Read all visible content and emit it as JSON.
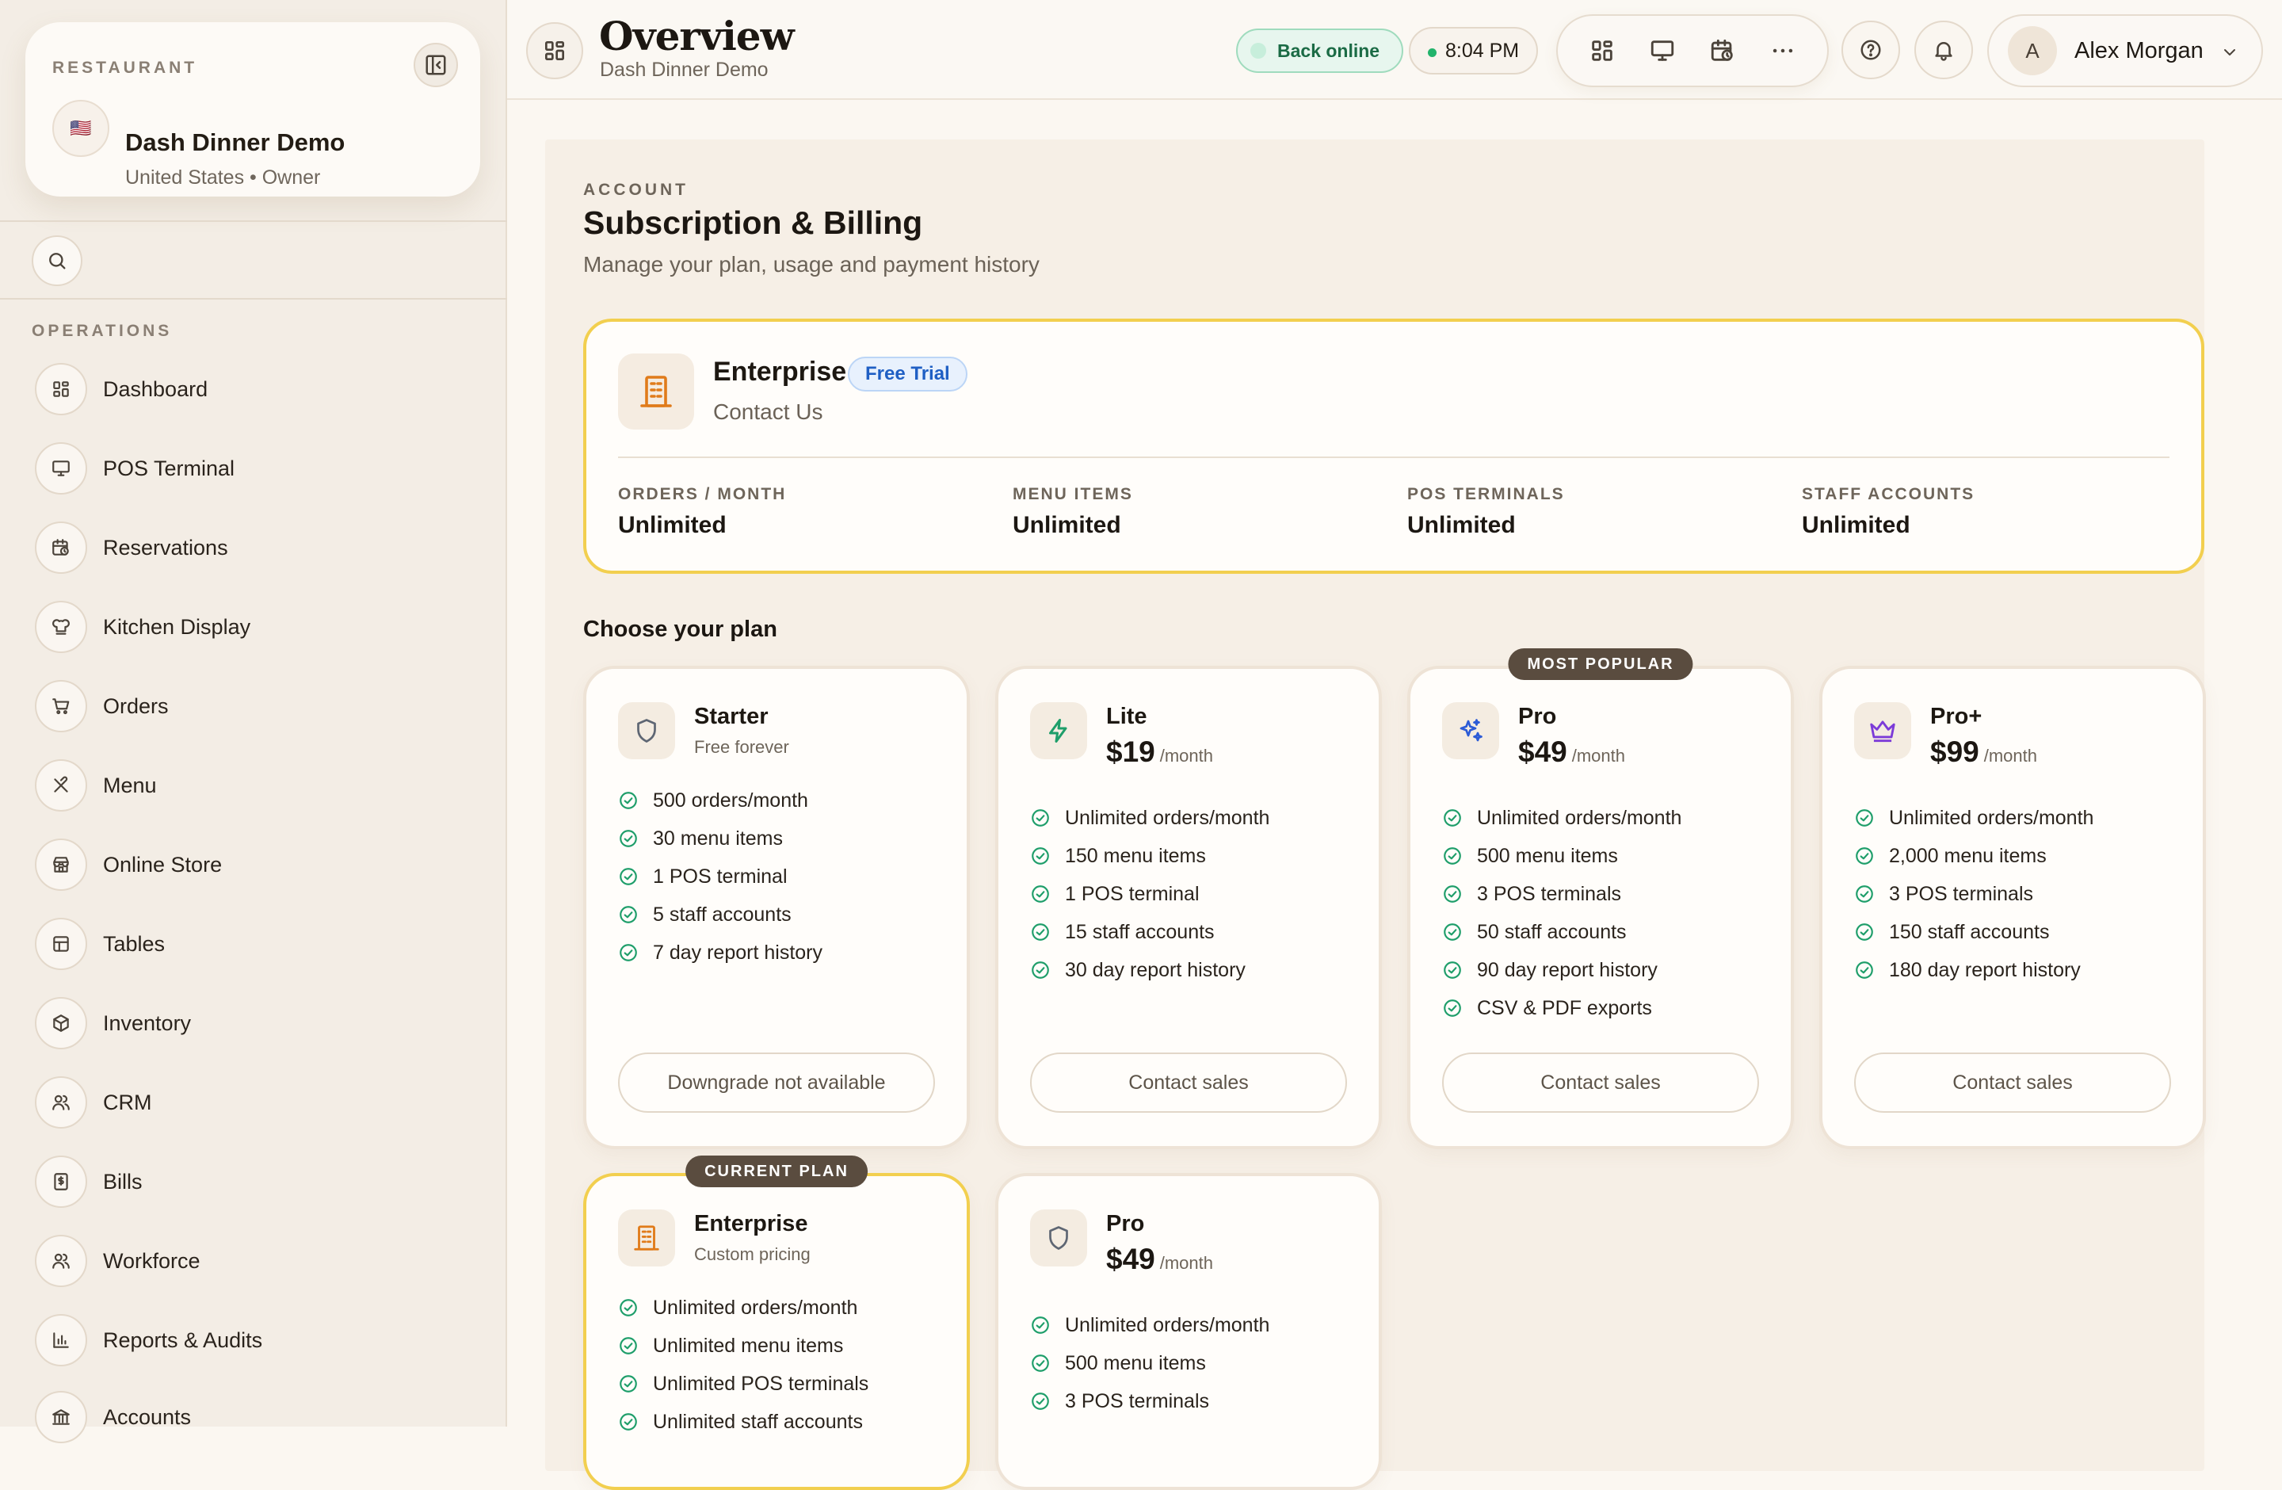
{
  "sidebar": {
    "restaurant_eyebrow": "RESTAURANT",
    "restaurant_name": "Dash Dinner Demo",
    "restaurant_meta": "United States • Owner",
    "flag": "🇺🇸",
    "section_label": "OPERATIONS",
    "items": [
      {
        "label": "Dashboard",
        "icon": "dashboard-icon"
      },
      {
        "label": "POS Terminal",
        "icon": "monitor-icon"
      },
      {
        "label": "Reservations",
        "icon": "calendar-clock-icon"
      },
      {
        "label": "Kitchen Display",
        "icon": "chef-hat-icon"
      },
      {
        "label": "Orders",
        "icon": "cart-icon"
      },
      {
        "label": "Menu",
        "icon": "utensils-icon"
      },
      {
        "label": "Online Store",
        "icon": "store-icon"
      },
      {
        "label": "Tables",
        "icon": "table-icon"
      },
      {
        "label": "Inventory",
        "icon": "package-icon"
      },
      {
        "label": "CRM",
        "icon": "users-icon"
      },
      {
        "label": "Bills",
        "icon": "receipt-icon"
      },
      {
        "label": "Workforce",
        "icon": "users-icon"
      },
      {
        "label": "Reports & Audits",
        "icon": "bar-chart-icon"
      },
      {
        "label": "Accounts",
        "icon": "bank-icon"
      }
    ]
  },
  "header": {
    "title": "Overview",
    "subtitle": "Dash Dinner Demo",
    "status": "Back online",
    "time": "8:04 PM",
    "user_initial": "A",
    "user_name": "Alex Morgan"
  },
  "main": {
    "eyebrow": "ACCOUNT",
    "title": "Subscription & Billing",
    "subtitle": "Manage your plan, usage and payment history",
    "current": {
      "name": "Enterprise",
      "badge": "Free Trial",
      "subtitle": "Contact Us",
      "stats": [
        {
          "label": "ORDERS / MONTH",
          "value": "Unlimited"
        },
        {
          "label": "MENU ITEMS",
          "value": "Unlimited"
        },
        {
          "label": "POS TERMINALS",
          "value": "Unlimited"
        },
        {
          "label": "STAFF ACCOUNTS",
          "value": "Unlimited"
        }
      ]
    },
    "choose_label": "Choose your plan",
    "per": "/month",
    "plans": [
      {
        "name": "Starter",
        "sub": "Free forever",
        "icon": "shield-icon",
        "features": [
          "500 orders/month",
          "30 menu items",
          "1 POS terminal",
          "5 staff accounts",
          "7 day report history"
        ],
        "button": "Downgrade not available"
      },
      {
        "name": "Lite",
        "price": "$19",
        "icon": "bolt-icon",
        "features": [
          "Unlimited orders/month",
          "150 menu items",
          "1 POS terminal",
          "15 staff accounts",
          "30 day report history"
        ],
        "button": "Contact sales"
      },
      {
        "name": "Pro",
        "price": "$49",
        "icon": "sparkles-icon",
        "ribbon": "MOST POPULAR",
        "features": [
          "Unlimited orders/month",
          "500 menu items",
          "3 POS terminals",
          "50 staff accounts",
          "90 day report history",
          "CSV & PDF exports"
        ],
        "button": "Contact sales"
      },
      {
        "name": "Pro+",
        "price": "$99",
        "icon": "crown-icon",
        "features": [
          "Unlimited orders/month",
          "2,000 menu items",
          "3 POS terminals",
          "150 staff accounts",
          "180 day report history"
        ],
        "button": "Contact sales"
      },
      {
        "name": "Enterprise",
        "sub": "Custom pricing",
        "icon": "building-icon",
        "ribbon": "CURRENT PLAN",
        "features": [
          "Unlimited orders/month",
          "Unlimited menu items",
          "Unlimited POS terminals",
          "Unlimited staff accounts"
        ]
      },
      {
        "name": "Pro",
        "price": "$49",
        "icon": "shield-icon",
        "features": [
          "Unlimited orders/month",
          "500 menu items",
          "3 POS terminals"
        ]
      }
    ]
  },
  "colors": {
    "accent_yellow": "#f2cf4f",
    "success_green": "#1e9e6a",
    "badge_blue": "#1f5fc4",
    "ribbon_brown": "#5a4c3f"
  }
}
